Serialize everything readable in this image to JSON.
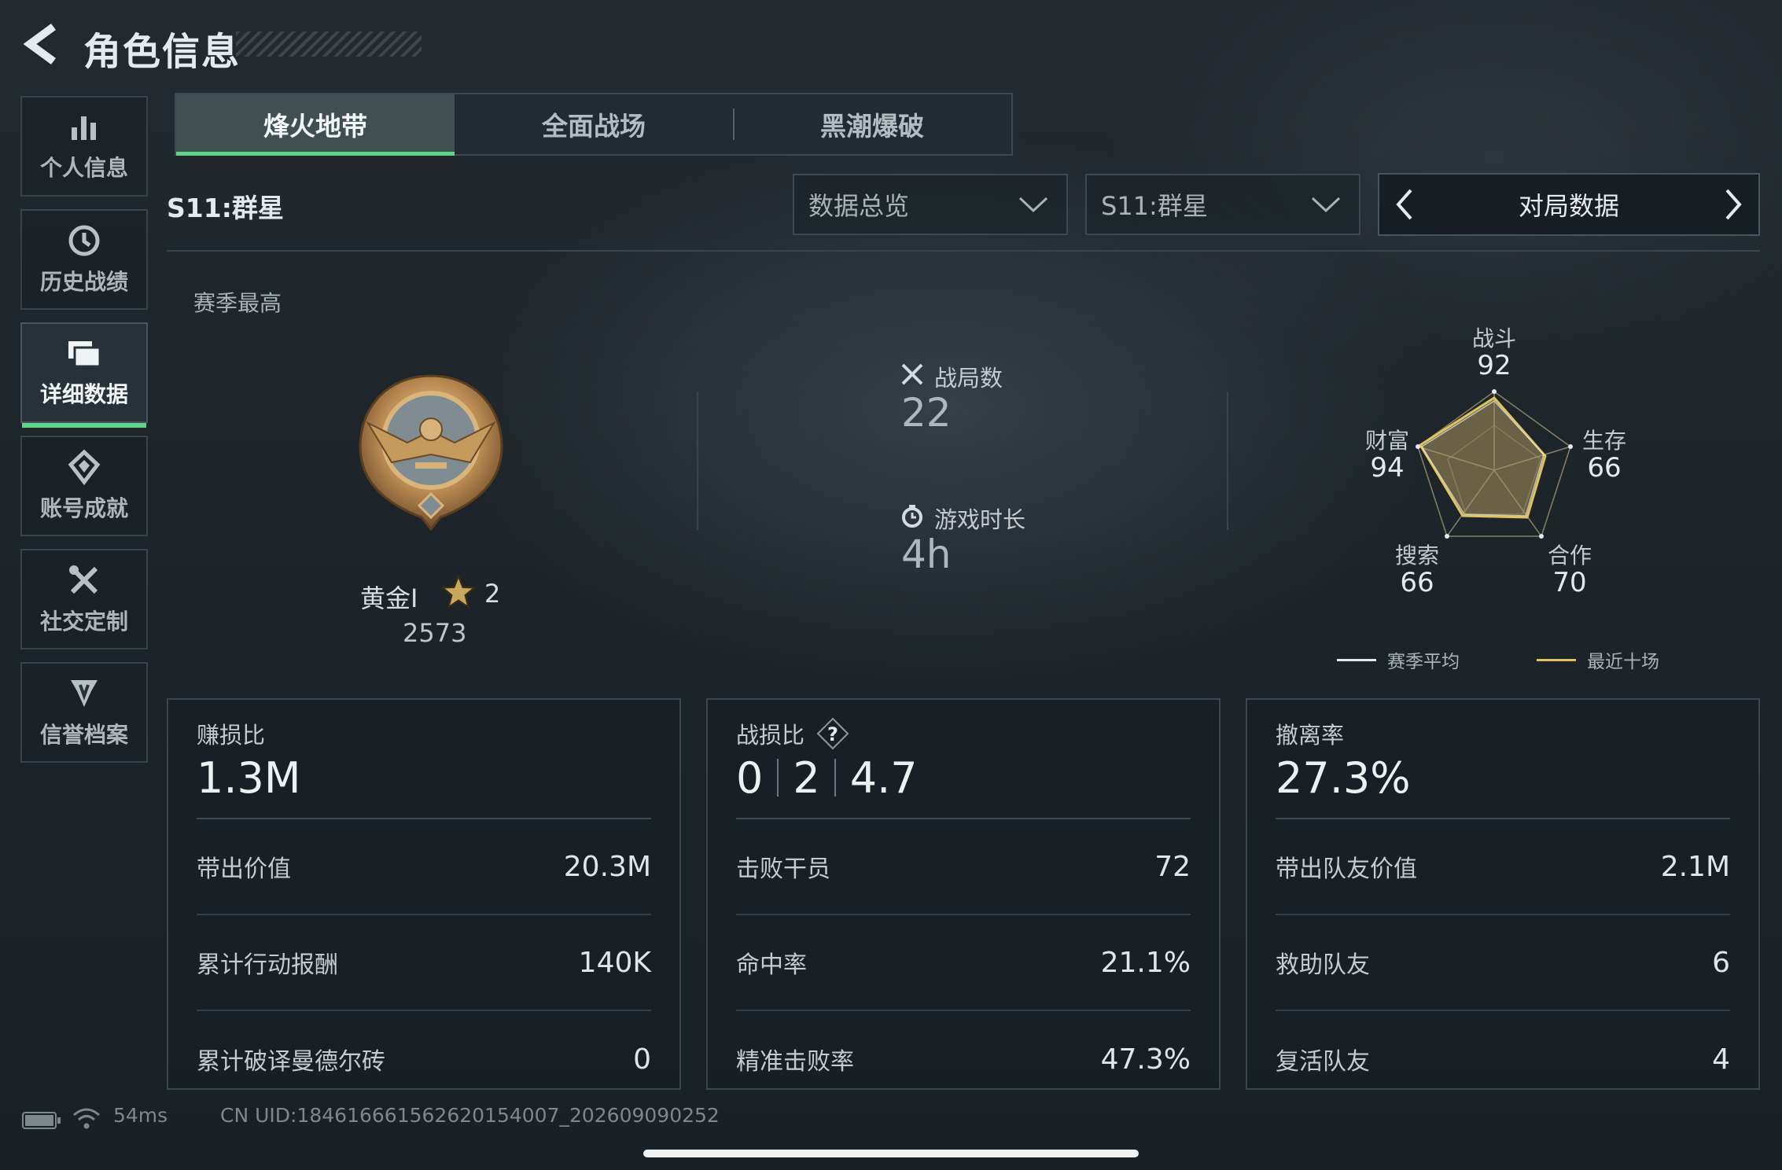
{
  "header": {
    "title": "角色信息"
  },
  "sidebar": {
    "items": [
      {
        "label": "个人信息",
        "icon": "bar-chart-icon"
      },
      {
        "label": "历史战绩",
        "icon": "history-clock-icon"
      },
      {
        "label": "详细数据",
        "icon": "data-folder-icon",
        "active": true
      },
      {
        "label": "账号成就",
        "icon": "achievement-icon"
      },
      {
        "label": "社交定制",
        "icon": "tools-icon"
      },
      {
        "label": "信誉档案",
        "icon": "reputation-shield-icon"
      }
    ]
  },
  "tabs": [
    {
      "label": "烽火地带",
      "active": true
    },
    {
      "label": "全面战场"
    },
    {
      "label": "黑潮爆破"
    }
  ],
  "filters": {
    "season_title": "S11:群星",
    "overview_select": "数据总览",
    "season_select": "S11:群星",
    "pager_label": "对局数据"
  },
  "rank": {
    "section_label": "赛季最高",
    "name": "黄金I",
    "stars": "2",
    "score": "2573"
  },
  "stats": {
    "matches_label": "战局数",
    "matches_value": "22",
    "time_label": "游戏时长",
    "time_value": "4h"
  },
  "radar": {
    "axes": [
      {
        "label": "战斗",
        "value": "92"
      },
      {
        "label": "生存",
        "value": "66"
      },
      {
        "label": "合作",
        "value": "70"
      },
      {
        "label": "搜索",
        "value": "66"
      },
      {
        "label": "财富",
        "value": "94"
      }
    ],
    "legend": [
      {
        "label": "赛季平均",
        "color": "#e6eaec"
      },
      {
        "label": "最近十场",
        "color": "#e2c25a"
      }
    ]
  },
  "cards": [
    {
      "title": "赚损比",
      "big": "1.3M",
      "rows": [
        {
          "k": "带出价值",
          "v": "20.3M"
        },
        {
          "k": "累计行动报酬",
          "v": "140K"
        },
        {
          "k": "累计破译曼德尔砖",
          "v": "0"
        }
      ]
    },
    {
      "title": "战损比",
      "big_parts": [
        "0",
        "2",
        "4.7"
      ],
      "rows": [
        {
          "k": "击败干员",
          "v": "72"
        },
        {
          "k": "命中率",
          "v": "21.1%"
        },
        {
          "k": "精准击败率",
          "v": "47.3%"
        }
      ]
    },
    {
      "title": "撤离率",
      "big": "27.3%",
      "rows": [
        {
          "k": "带出队友价值",
          "v": "2.1M"
        },
        {
          "k": "救助队友",
          "v": "6"
        },
        {
          "k": "复活队友",
          "v": "4"
        }
      ]
    }
  ],
  "footer": {
    "ping": "54ms",
    "uid": "CN UID:18461666156262015400​7_202609090252"
  },
  "colors": {
    "accent": "#5fd58a",
    "gold": "#e2c25a"
  }
}
